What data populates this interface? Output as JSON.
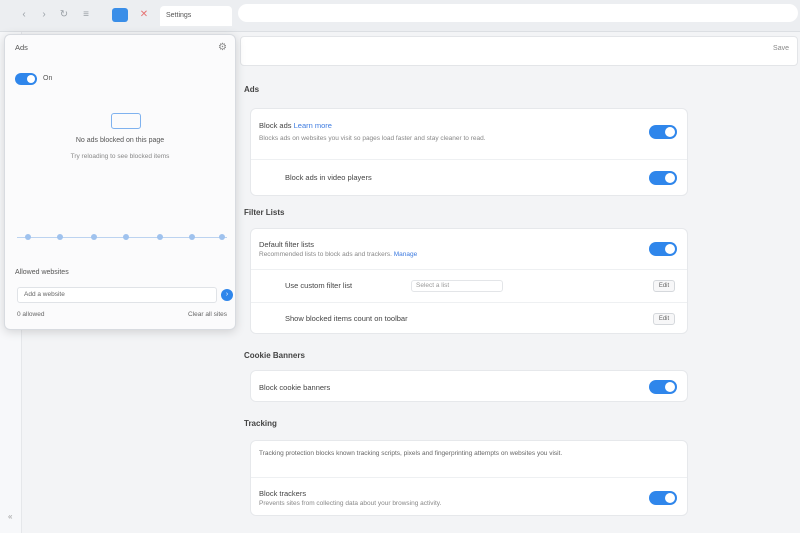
{
  "browser": {
    "tab_title": "Settings",
    "back_icon": "back-arrow-icon",
    "forward_icon": "forward-arrow-icon",
    "refresh_icon": "refresh-icon",
    "extension_icon": "extension-icon",
    "blocker_icon": "stop-icon"
  },
  "search_strip": {
    "button_label": "Save"
  },
  "sections": [
    {
      "title": "Ads"
    },
    {
      "title": "Filter Lists"
    },
    {
      "title": "Cookie Banners"
    },
    {
      "title": "Tracking"
    }
  ],
  "ads_card": {
    "row1_label": "Block ads",
    "row1_link": "Learn more",
    "row1_desc": "Blocks ads on websites you visit so pages load faster and stay cleaner to read.",
    "row1_toggle": true,
    "row2_label": "Block ads in video players",
    "row2_toggle": true
  },
  "filters_card": {
    "row1_label": "Default filter lists",
    "row1_desc": "Recommended lists to block ads and trackers.",
    "row1_link": "Manage",
    "row1_toggle": true,
    "row2_label": "Use custom filter list",
    "row2_select": "Select a list",
    "row2_button": "Edit",
    "row3_label": "Show blocked items count on toolbar",
    "row3_button": "Edit"
  },
  "cookie_card": {
    "row1_label": "Block cookie banners",
    "row1_toggle": true
  },
  "tracking_card": {
    "row1_desc": "Tracking protection blocks known tracking scripts, pixels and fingerprinting attempts on websites you visit.",
    "row2_label": "Block trackers",
    "row2_desc": "Prevents sites from collecting data about your browsing activity.",
    "row2_toggle": true
  },
  "popup": {
    "title": "Ads",
    "gear_icon": "gear-icon",
    "toggle_label": "On",
    "shield_icon": "shield-icon",
    "message": "No ads blocked on this page",
    "submessage": "Try reloading to see blocked items",
    "section_label": "Allowed websites",
    "input_value": "Add a website",
    "go_icon": "arrow-right-icon",
    "footer_left": "0 allowed",
    "footer_right": "Clear all sites"
  }
}
